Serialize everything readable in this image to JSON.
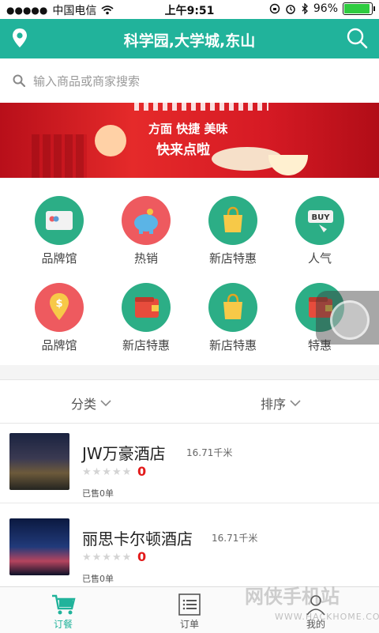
{
  "status_bar": {
    "carrier": "中国电信",
    "time": "上午9:51",
    "battery": "96%",
    "battery_level": 0.96
  },
  "header": {
    "title": "科学园,大学城,东山",
    "location_icon": "location-pin-icon",
    "search_icon": "search-icon",
    "bg_color": "#21b39b"
  },
  "search": {
    "placeholder": "输入商品或商家搜索"
  },
  "banner": {
    "line1": "方面 快捷 美味",
    "line2": "快来点啦"
  },
  "categories": [
    {
      "label": "品牌馆",
      "icon": "card-icon",
      "color": "green"
    },
    {
      "label": "热销",
      "icon": "piggy-bank-icon",
      "color": "red"
    },
    {
      "label": "新店特惠",
      "icon": "shopping-bag-icon",
      "color": "green"
    },
    {
      "label": "人气",
      "icon": "buy-tag-icon",
      "color": "green"
    },
    {
      "label": "品牌馆",
      "icon": "location-dollar-icon",
      "color": "red"
    },
    {
      "label": "新店特惠",
      "icon": "wallet-icon",
      "color": "green"
    },
    {
      "label": "新店特惠",
      "icon": "shopping-bag-icon",
      "color": "green"
    },
    {
      "label": "特惠",
      "icon": "wallet-icon",
      "color": "green"
    }
  ],
  "filters": {
    "category": "分类",
    "sort": "排序"
  },
  "restaurants": [
    {
      "name": "JW万豪酒店",
      "distance": "16.71千米",
      "score": "0",
      "sold": "已售0单"
    },
    {
      "name": "丽思卡尔顿酒店",
      "distance": "16.71千米",
      "score": "0",
      "sold": "已售0单"
    }
  ],
  "tabs": [
    {
      "label": "订餐",
      "icon": "cart-icon"
    },
    {
      "label": "订单",
      "icon": "list-icon"
    },
    {
      "label": "我的",
      "icon": "user-icon"
    }
  ],
  "watermark": {
    "text": "网侠手机站",
    "url": "WWW.HACKHOME.COM"
  }
}
